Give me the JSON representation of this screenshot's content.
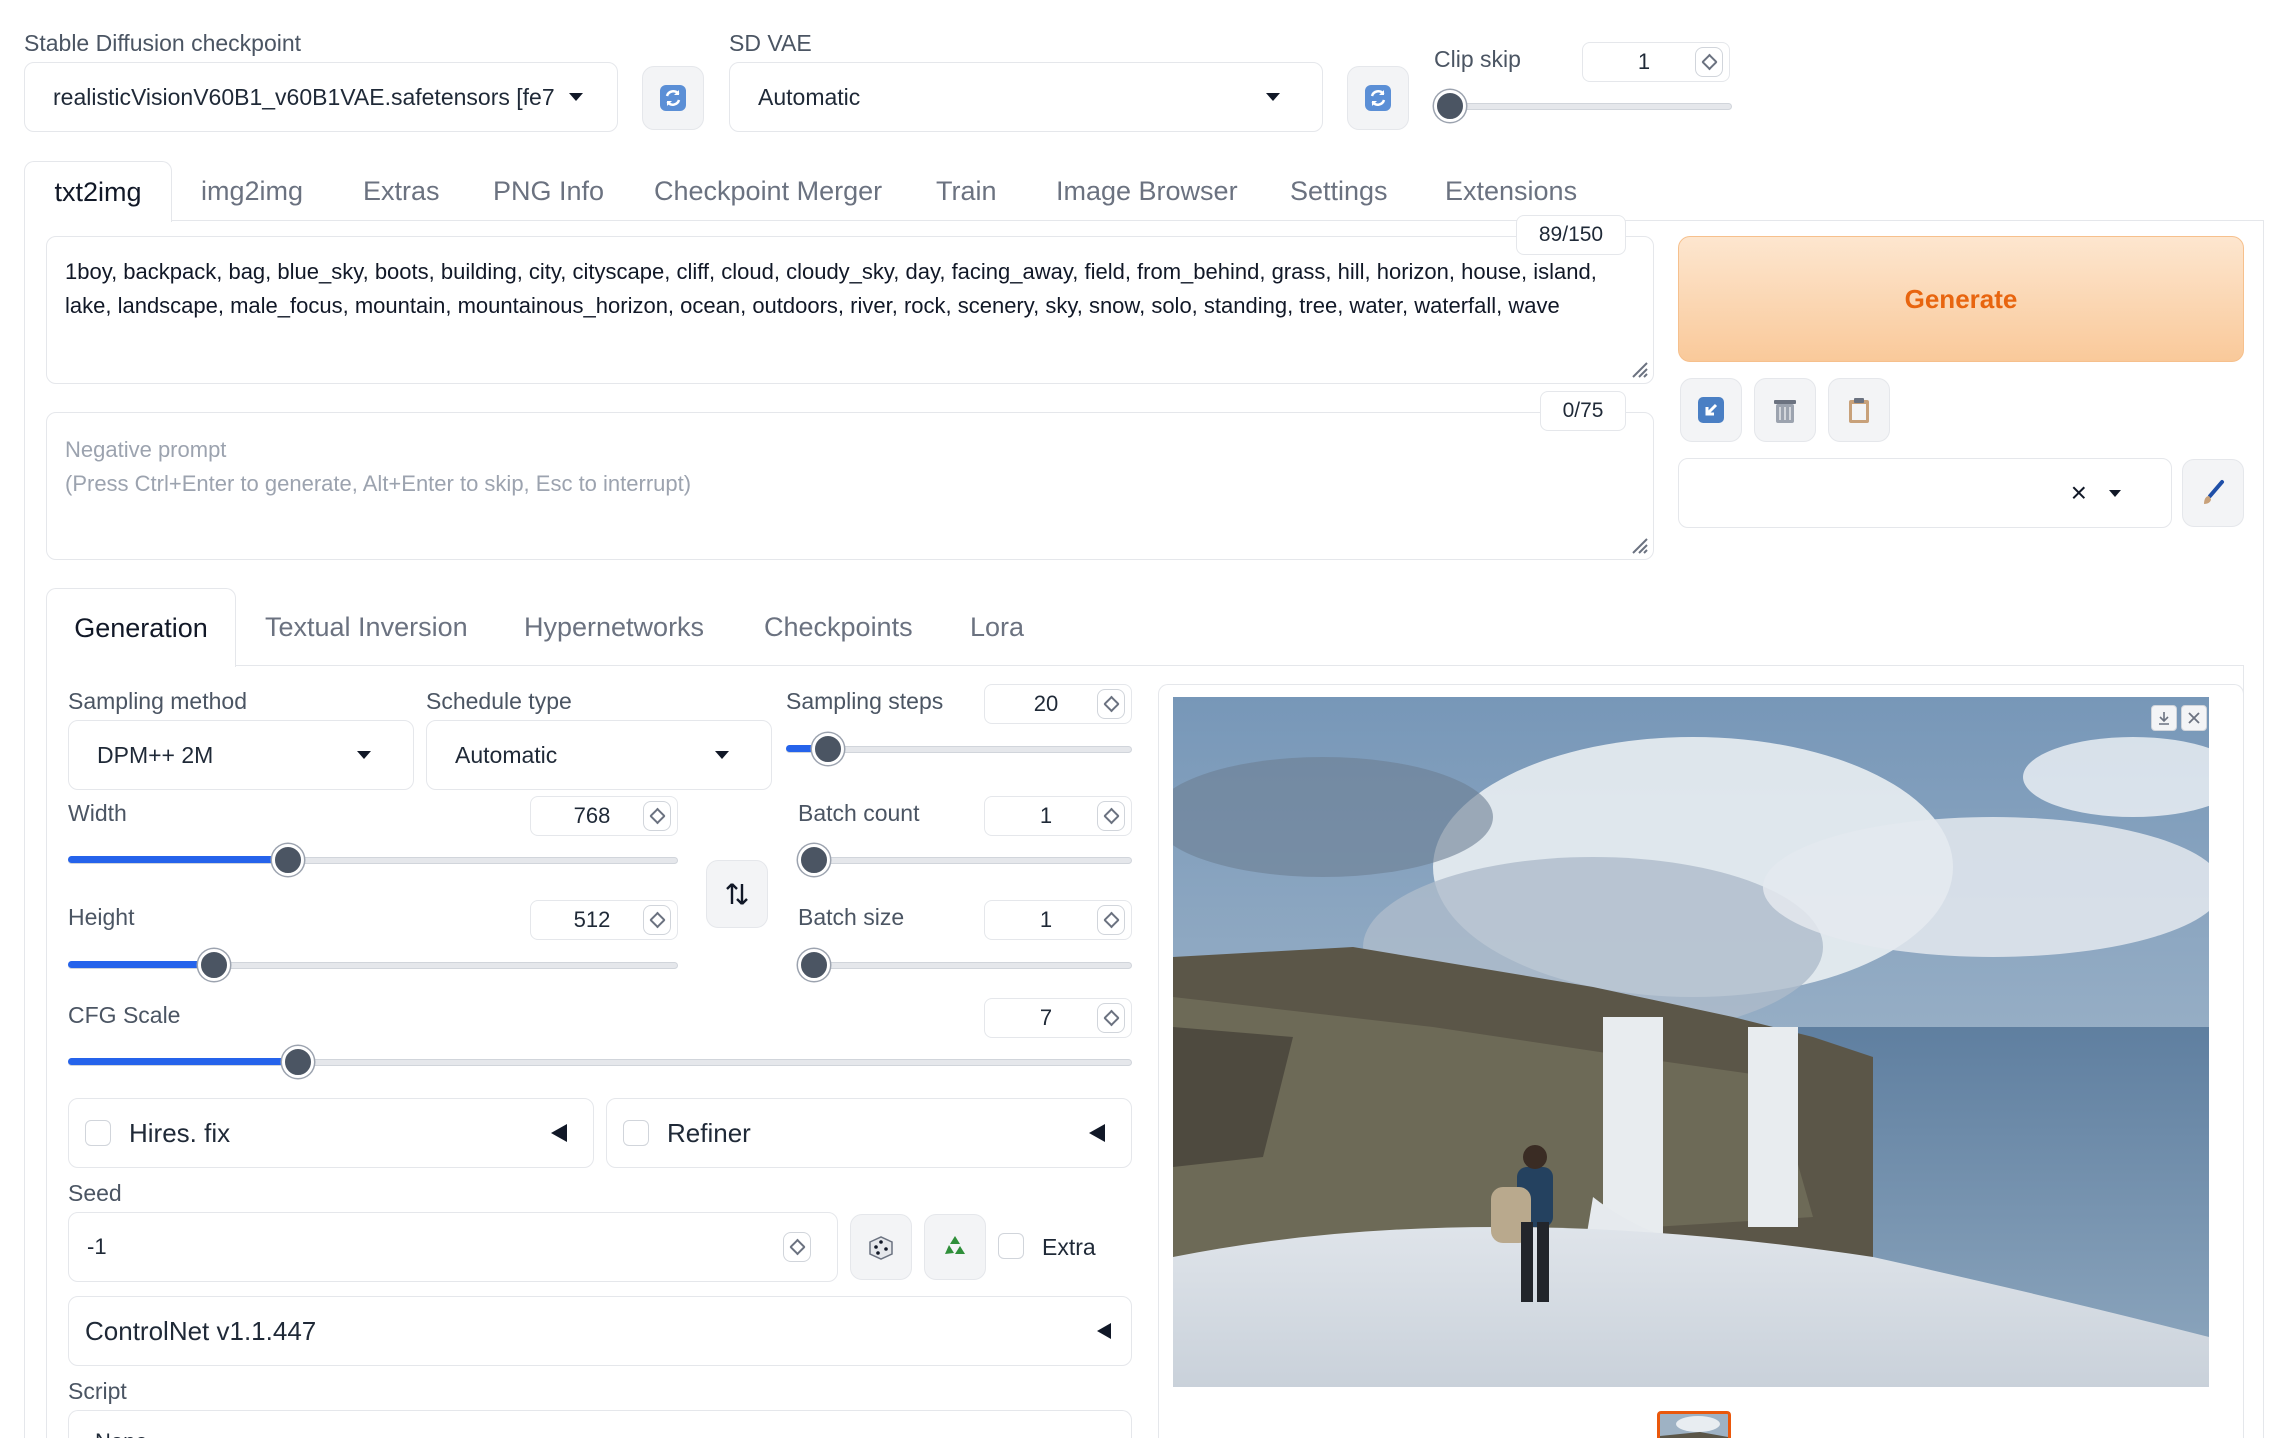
{
  "top": {
    "checkpoint_label": "Stable Diffusion checkpoint",
    "checkpoint_value": "realisticVisionV60B1_v60B1VAE.safetensors [fe7",
    "vae_label": "SD VAE",
    "vae_value": "Automatic",
    "clip_skip_label": "Clip skip",
    "clip_skip_value": "1",
    "clip_skip_fraction": 0.0
  },
  "main_tabs": [
    "txt2img",
    "img2img",
    "Extras",
    "PNG Info",
    "Checkpoint Merger",
    "Train",
    "Image Browser",
    "Settings",
    "Extensions"
  ],
  "prompt": {
    "token_count": "89/150",
    "text": "1boy, backpack, bag, blue_sky, boots, building, city, cityscape, cliff, cloud, cloudy_sky, day, facing_away, field, from_behind, grass, hill, horizon, house, island, lake, landscape, male_focus, mountain, mountainous_horizon, ocean, outdoors, river, rock, scenery, sky, snow, solo, standing, tree, water, waterfall, wave"
  },
  "negative": {
    "token_count": "0/75",
    "placeholder_line1": "Negative prompt",
    "placeholder_line2": "(Press Ctrl+Enter to generate, Alt+Enter to skip, Esc to interrupt)"
  },
  "generate_label": "Generate",
  "colors": {
    "accent": "#2563eb",
    "generate_bg": "#fbd9b8",
    "generate_text": "#e8650f",
    "thumb_border": "#ea580c"
  },
  "sub_tabs": [
    "Generation",
    "Textual Inversion",
    "Hypernetworks",
    "Checkpoints",
    "Lora"
  ],
  "sampling": {
    "method_label": "Sampling method",
    "method_value": "DPM++ 2M",
    "schedule_label": "Schedule type",
    "schedule_value": "Automatic",
    "steps_label": "Sampling steps",
    "steps_value": "20"
  },
  "width": {
    "label": "Width",
    "value": "768"
  },
  "height": {
    "label": "Height",
    "value": "512"
  },
  "batch_count": {
    "label": "Batch count",
    "value": "1"
  },
  "batch_size": {
    "label": "Batch size",
    "value": "1"
  },
  "cfg": {
    "label": "CFG Scale",
    "value": "7"
  },
  "hires_label": "Hires. fix",
  "refiner_label": "Refiner",
  "seed": {
    "label": "Seed",
    "value": "-1",
    "extra_label": "Extra"
  },
  "controlnet_label": "ControlNet v1.1.447",
  "script_label": "Script",
  "script_value": "None"
}
